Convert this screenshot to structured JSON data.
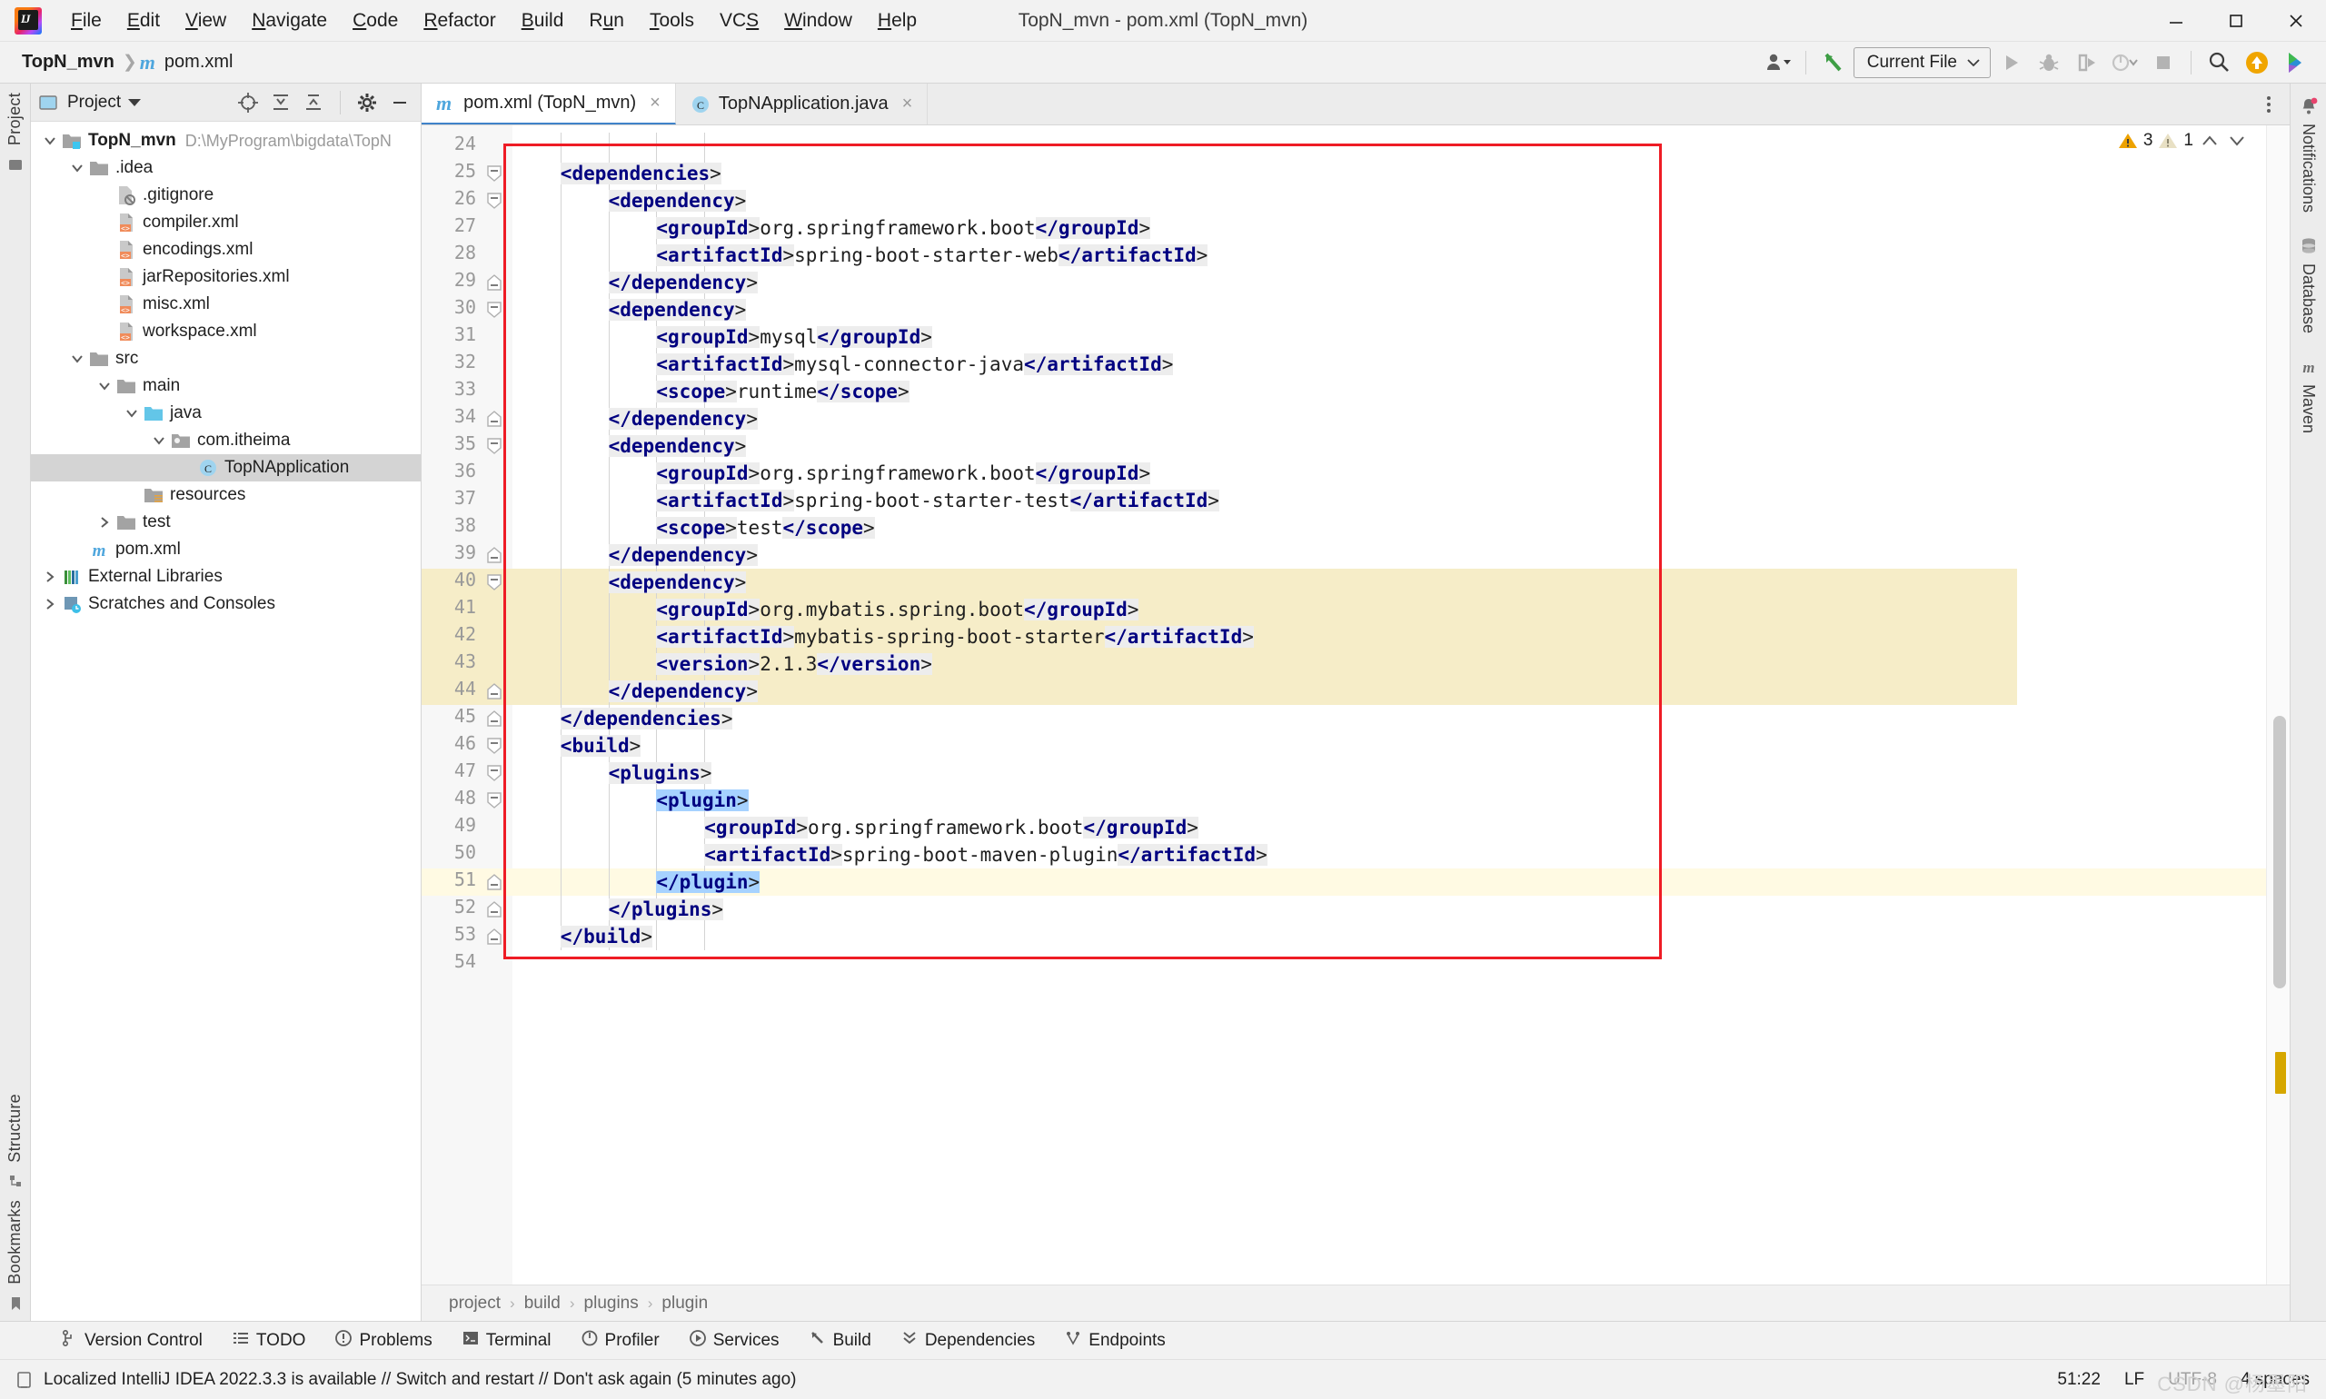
{
  "window": {
    "title": "TopN_mvn - pom.xml (TopN_mvn)",
    "minimize": "minimize-button",
    "maximize": "maximize-button",
    "close": "close-button"
  },
  "menu": [
    {
      "label": "File",
      "mnemonic": "F"
    },
    {
      "label": "Edit",
      "mnemonic": "E"
    },
    {
      "label": "View",
      "mnemonic": "V"
    },
    {
      "label": "Navigate",
      "mnemonic": "N"
    },
    {
      "label": "Code",
      "mnemonic": "C"
    },
    {
      "label": "Refactor",
      "mnemonic": "R"
    },
    {
      "label": "Build",
      "mnemonic": "B"
    },
    {
      "label": "Run",
      "mnemonic": "u"
    },
    {
      "label": "Tools",
      "mnemonic": "T"
    },
    {
      "label": "VCS",
      "mnemonic": "S"
    },
    {
      "label": "Window",
      "mnemonic": "W"
    },
    {
      "label": "Help",
      "mnemonic": "H"
    }
  ],
  "navbar": {
    "crumbs": [
      "TopN_mvn",
      "pom.xml"
    ],
    "run_config": "Current File",
    "icons": [
      "user-settings-icon",
      "build-hammer-icon",
      "run-icon",
      "debug-icon",
      "run-with-coverage-icon",
      "profile-icon",
      "stop-icon",
      "search-everywhere-icon",
      "update-project-icon",
      "ide-assistant-icon"
    ]
  },
  "project_panel": {
    "title": "Project",
    "header_icons": [
      "select-opened-file-icon",
      "expand-all-icon",
      "collapse-all-icon",
      "settings-gear-icon",
      "hide-panel-icon"
    ],
    "tree": [
      {
        "label": "TopN_mvn",
        "path": "D:\\MyProgram\\bigdata\\TopN",
        "depth": 0,
        "icon": "module-folder-icon",
        "arrow": "down",
        "bold": true
      },
      {
        "label": ".idea",
        "depth": 1,
        "icon": "folder-icon",
        "arrow": "down"
      },
      {
        "label": ".gitignore",
        "depth": 2,
        "icon": "gitignore-file-icon",
        "arrow": "none"
      },
      {
        "label": "compiler.xml",
        "depth": 2,
        "icon": "xml-file-icon",
        "arrow": "none"
      },
      {
        "label": "encodings.xml",
        "depth": 2,
        "icon": "xml-file-icon",
        "arrow": "none"
      },
      {
        "label": "jarRepositories.xml",
        "depth": 2,
        "icon": "xml-file-icon",
        "arrow": "none"
      },
      {
        "label": "misc.xml",
        "depth": 2,
        "icon": "xml-file-icon",
        "arrow": "none"
      },
      {
        "label": "workspace.xml",
        "depth": 2,
        "icon": "xml-file-icon",
        "arrow": "none"
      },
      {
        "label": "src",
        "depth": 1,
        "icon": "folder-icon",
        "arrow": "down"
      },
      {
        "label": "main",
        "depth": 2,
        "icon": "folder-icon",
        "arrow": "down"
      },
      {
        "label": "java",
        "depth": 3,
        "icon": "source-folder-icon",
        "arrow": "down"
      },
      {
        "label": "com.itheima",
        "depth": 4,
        "icon": "package-icon",
        "arrow": "down"
      },
      {
        "label": "TopNApplication",
        "depth": 5,
        "icon": "java-class-icon",
        "arrow": "none",
        "selected": true
      },
      {
        "label": "resources",
        "depth": 3,
        "icon": "resources-folder-icon",
        "arrow": "none"
      },
      {
        "label": "test",
        "depth": 2,
        "icon": "folder-icon",
        "arrow": "right"
      },
      {
        "label": "pom.xml",
        "depth": 1,
        "icon": "maven-file-icon",
        "arrow": "none"
      },
      {
        "label": "External Libraries",
        "depth": 0,
        "icon": "libraries-icon",
        "arrow": "right"
      },
      {
        "label": "Scratches and Consoles",
        "depth": 0,
        "icon": "scratches-icon",
        "arrow": "right"
      }
    ]
  },
  "tabs": [
    {
      "label": "pom.xml (TopN_mvn)",
      "icon": "maven-file-icon",
      "active": true,
      "close": "×"
    },
    {
      "label": "TopNApplication.java",
      "icon": "java-class-icon",
      "active": false,
      "close": "×"
    }
  ],
  "inspection_widget": {
    "warnings": "3",
    "weak_warnings": "1",
    "prev": "prev-problem-icon",
    "next": "next-problem-icon"
  },
  "editor": {
    "first_visible_line": 24,
    "caret_line": 51,
    "lines": [
      {
        "n": 24,
        "text": "",
        "indent": 0
      },
      {
        "n": 25,
        "text": "<dependencies>",
        "indent": 1,
        "fold": "collapse"
      },
      {
        "n": 26,
        "text": "<dependency>",
        "indent": 2,
        "fold": "collapse"
      },
      {
        "n": 27,
        "text": "<groupId>org.springframework.boot</groupId>",
        "indent": 3
      },
      {
        "n": 28,
        "text": "<artifactId>spring-boot-starter-web</artifactId>",
        "indent": 3
      },
      {
        "n": 29,
        "text": "</dependency>",
        "indent": 2,
        "fold": "end"
      },
      {
        "n": 30,
        "text": "<dependency>",
        "indent": 2,
        "fold": "collapse"
      },
      {
        "n": 31,
        "text": "<groupId>mysql</groupId>",
        "indent": 3
      },
      {
        "n": 32,
        "text": "<artifactId>mysql-connector-java</artifactId>",
        "indent": 3
      },
      {
        "n": 33,
        "text": "<scope>runtime</scope>",
        "indent": 3
      },
      {
        "n": 34,
        "text": "</dependency>",
        "indent": 2,
        "fold": "end"
      },
      {
        "n": 35,
        "text": "<dependency>",
        "indent": 2,
        "fold": "collapse"
      },
      {
        "n": 36,
        "text": "<groupId>org.springframework.boot</groupId>",
        "indent": 3
      },
      {
        "n": 37,
        "text": "<artifactId>spring-boot-starter-test</artifactId>",
        "indent": 3
      },
      {
        "n": 38,
        "text": "<scope>test</scope>",
        "indent": 3
      },
      {
        "n": 39,
        "text": "</dependency>",
        "indent": 2,
        "fold": "end"
      },
      {
        "n": 40,
        "text": "<dependency>",
        "indent": 2,
        "fold": "collapse",
        "highlight": "yellow"
      },
      {
        "n": 41,
        "text": "<groupId>org.mybatis.spring.boot</groupId>",
        "indent": 3,
        "highlight": "yellow"
      },
      {
        "n": 42,
        "text": "<artifactId>mybatis-spring-boot-starter</artifactId>",
        "indent": 3,
        "highlight": "yellow"
      },
      {
        "n": 43,
        "text": "<version>2.1.3</version>",
        "indent": 3,
        "highlight": "yellow"
      },
      {
        "n": 44,
        "text": "</dependency>",
        "indent": 2,
        "fold": "end",
        "highlight": "yellow"
      },
      {
        "n": 45,
        "text": "</dependencies>",
        "indent": 1,
        "fold": "end"
      },
      {
        "n": 46,
        "text": "<build>",
        "indent": 1,
        "fold": "collapse"
      },
      {
        "n": 47,
        "text": "<plugins>",
        "indent": 2,
        "fold": "collapse"
      },
      {
        "n": 48,
        "text": "<plugin>",
        "indent": 3,
        "fold": "collapse",
        "select": true
      },
      {
        "n": 49,
        "text": "<groupId>org.springframework.boot</groupId>",
        "indent": 4
      },
      {
        "n": 50,
        "text": "<artifactId>spring-boot-maven-plugin</artifactId>",
        "indent": 4
      },
      {
        "n": 51,
        "text": "</plugin>",
        "indent": 3,
        "fold": "end",
        "select": true,
        "caret": true
      },
      {
        "n": 52,
        "text": "</plugins>",
        "indent": 2,
        "fold": "end"
      },
      {
        "n": 53,
        "text": "</build>",
        "indent": 1,
        "fold": "end"
      },
      {
        "n": 54,
        "text": "",
        "indent": 0
      }
    ]
  },
  "editor_breadcrumb": [
    "project",
    "build",
    "plugins",
    "plugin"
  ],
  "right_tools": [
    {
      "label": "Notifications",
      "icon": "notifications-bell-icon",
      "badge": true
    },
    {
      "label": "Database",
      "icon": "database-icon"
    },
    {
      "label": "Maven",
      "icon": "maven-icon"
    }
  ],
  "left_tools": [
    {
      "label": "Project",
      "icon": "project-icon"
    },
    {
      "label": "Structure",
      "icon": "structure-icon"
    },
    {
      "label": "Bookmarks",
      "icon": "bookmarks-icon"
    }
  ],
  "tool_strip": [
    {
      "label": "Version Control",
      "icon": "branch-icon"
    },
    {
      "label": "TODO",
      "icon": "todo-icon"
    },
    {
      "label": "Problems",
      "icon": "problems-icon"
    },
    {
      "label": "Terminal",
      "icon": "terminal-icon"
    },
    {
      "label": "Profiler",
      "icon": "profiler-icon"
    },
    {
      "label": "Services",
      "icon": "services-icon"
    },
    {
      "label": "Build",
      "icon": "build-icon"
    },
    {
      "label": "Dependencies",
      "icon": "dependencies-icon"
    },
    {
      "label": "Endpoints",
      "icon": "endpoints-icon"
    }
  ],
  "statusbar": {
    "message": "Localized IntelliJ IDEA 2022.3.3 is available // Switch and restart // Don't ask again (5 minutes ago)",
    "message_icon": "ide-update-icon",
    "position": "51:22",
    "line_separator": "LF",
    "encoding": "UTF-8",
    "indent": "4 spaces",
    "watermark": "CSDN @杨墨阳"
  },
  "colors": {
    "tag": "#000080",
    "tag_bg": "#ededed",
    "selection": "#a6d2ff",
    "yellow_highlight": "#f6edc8",
    "caret_line": "#fffae3",
    "red_box": "#ee1c25",
    "accent_blue": "#4083c9",
    "warning": "#eda200"
  }
}
